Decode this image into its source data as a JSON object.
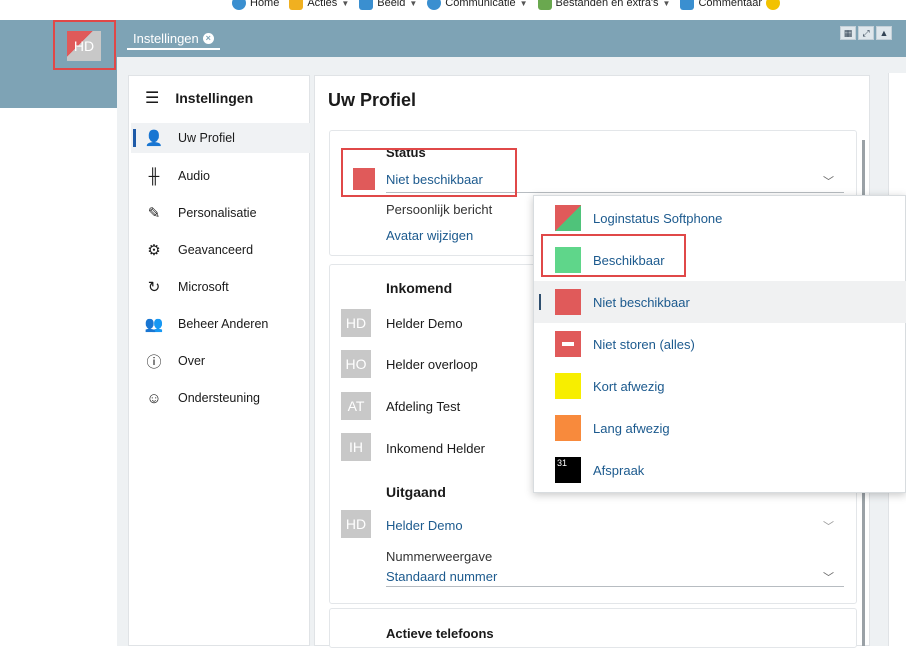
{
  "ribbon": {
    "items": [
      {
        "label": "Home",
        "color": "#3a8fd0"
      },
      {
        "label": "Acties",
        "color": "#f0b020"
      },
      {
        "label": "Beeld",
        "color": "#3a8fd0"
      },
      {
        "label": "Communicatie",
        "color": "#3a8fd0"
      },
      {
        "label": "Bestanden en extra's",
        "color": "#6aa84f"
      },
      {
        "label": "Commentaar",
        "color": "#3a8fd0"
      }
    ]
  },
  "header": {
    "avatar_initials": "HD",
    "tab_label": "Instellingen",
    "band_color": "#7ea3b5"
  },
  "nav": {
    "title": "Instellingen",
    "items": [
      {
        "label": "Uw Profiel",
        "icon": "user-gear-icon"
      },
      {
        "label": "Audio",
        "icon": "waveform-icon"
      },
      {
        "label": "Personalisatie",
        "icon": "brush-icon"
      },
      {
        "label": "Geavanceerd",
        "icon": "gears-icon"
      },
      {
        "label": "Microsoft",
        "icon": "sync-icon"
      },
      {
        "label": "Beheer Anderen",
        "icon": "users-icon"
      },
      {
        "label": "Over",
        "icon": "info-icon"
      },
      {
        "label": "Ondersteuning",
        "icon": "support-icon"
      }
    ]
  },
  "main": {
    "title": "Uw Profiel",
    "status": {
      "label": "Status",
      "value": "Niet beschikbaar",
      "color": "#e05a5a",
      "personal_message_label": "Persoonlijk bericht",
      "avatar_link": "Avatar wijzigen"
    },
    "incoming": {
      "title": "Inkomend",
      "items": [
        {
          "initials": "HD",
          "name": "Helder Demo"
        },
        {
          "initials": "HO",
          "name": "Helder overloop"
        },
        {
          "initials": "AT",
          "name": "Afdeling Test"
        },
        {
          "initials": "IH",
          "name": "Inkomend Helder"
        }
      ]
    },
    "outgoing": {
      "title": "Uitgaand",
      "initials": "HD",
      "selected": "Helder Demo",
      "number_label": "Nummerweergave",
      "number_value": "Standaard nummer"
    },
    "active_phones": {
      "title": "Actieve telefoons"
    }
  },
  "dropdown": {
    "options": [
      {
        "label": "Loginstatus Softphone",
        "color": "#e05a5a",
        "color2": "#4fc37a"
      },
      {
        "label": "Beschikbaar",
        "color": "#5fd68a"
      },
      {
        "label": "Niet beschikbaar",
        "color": "#e05a5a",
        "selected": true
      },
      {
        "label": "Niet storen (alles)",
        "color": "#e05a5a"
      },
      {
        "label": "Kort afwezig",
        "color": "#f7ee00"
      },
      {
        "label": "Lang afwezig",
        "color": "#f88a3c"
      },
      {
        "label": "Afspraak",
        "color": "#000000",
        "badge": "31"
      }
    ]
  },
  "highlight_color": "#e04848"
}
